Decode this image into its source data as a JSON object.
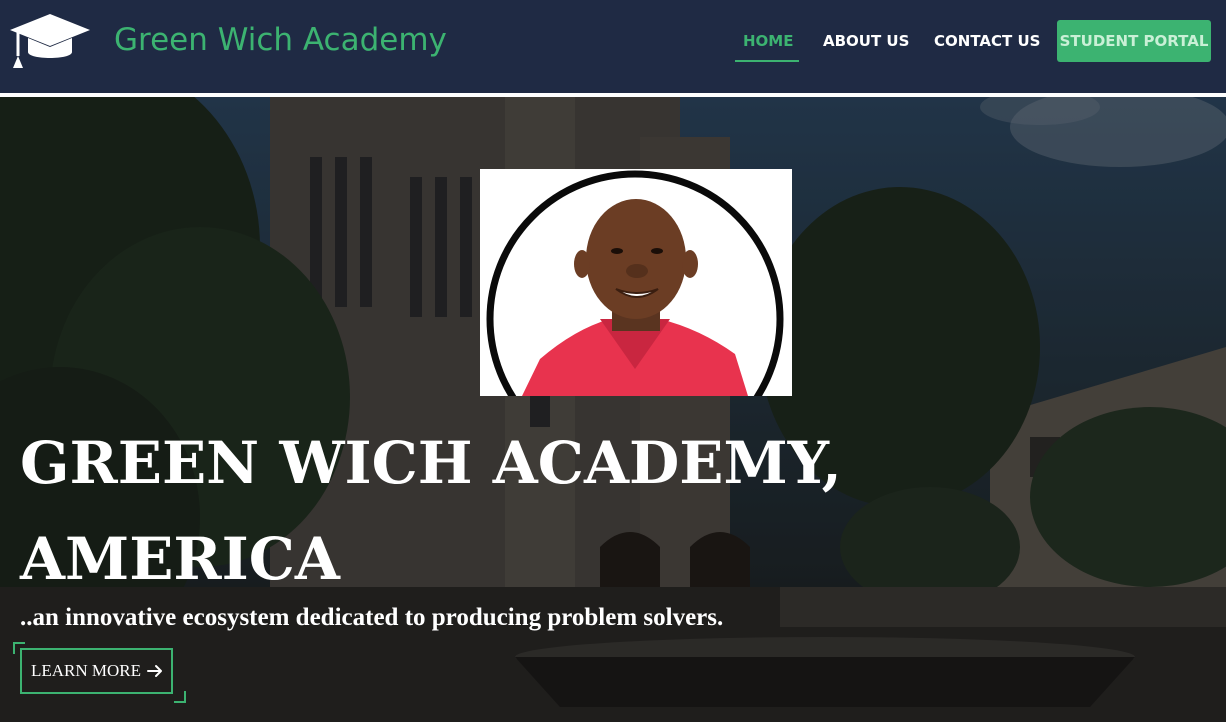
{
  "header": {
    "brand": "Green Wich Academy",
    "logo_icon": "graduation-cap-icon",
    "nav": {
      "home": "HOME",
      "about": "ABOUT US",
      "contact": "CONTACT US",
      "portal": "STUDENT PORTAL"
    },
    "active_nav": "home"
  },
  "hero": {
    "title": "GREEN WICH ACADEMY, AMERICA",
    "subtitle": "..an innovative ecosystem dedicated to producing problem solvers.",
    "cta_label": "LEARN MORE",
    "cta_icon": "arrow-right-icon",
    "portrait_icon": "student-portrait"
  },
  "colors": {
    "navbar_bg": "#1f2a44",
    "accent_green": "#3cb371",
    "text_white": "#ffffff"
  }
}
